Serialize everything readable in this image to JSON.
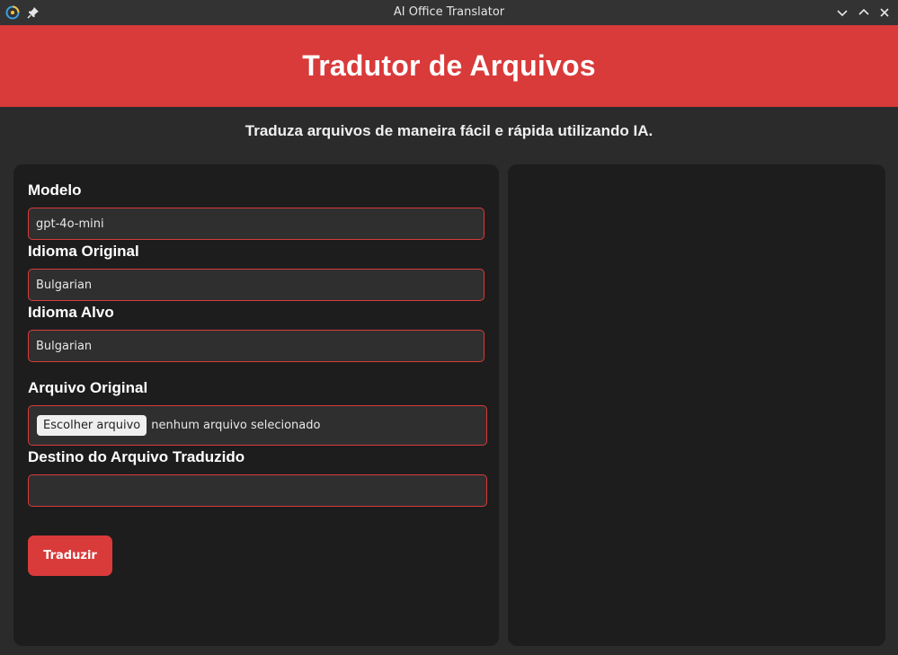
{
  "window": {
    "title": "AI Office Translator"
  },
  "header": {
    "title": "Tradutor de Arquivos",
    "subtitle": "Traduza arquivos de maneira fácil e rápida utilizando IA."
  },
  "form": {
    "model": {
      "label": "Modelo",
      "value": "gpt-4o-mini"
    },
    "source_language": {
      "label": "Idioma Original",
      "value": "Bulgarian"
    },
    "target_language": {
      "label": "Idioma Alvo",
      "value": "Bulgarian"
    },
    "original_file": {
      "label": "Arquivo Original",
      "button_label": "Escolher arquivo",
      "status": "nenhum arquivo selecionado"
    },
    "destination": {
      "label": "Destino do Arquivo Traduzido",
      "value": ""
    },
    "submit_label": "Traduzir"
  },
  "colors": {
    "accent": "#d93a3a",
    "panel": "#1d1d1d",
    "background": "#2b2b2b",
    "titlebar": "#333333"
  },
  "icons": {
    "app": "app-logo-icon",
    "pin": "pin-icon",
    "minimize": "chevron-down-icon",
    "maximize": "chevron-up-icon",
    "close": "close-icon"
  }
}
